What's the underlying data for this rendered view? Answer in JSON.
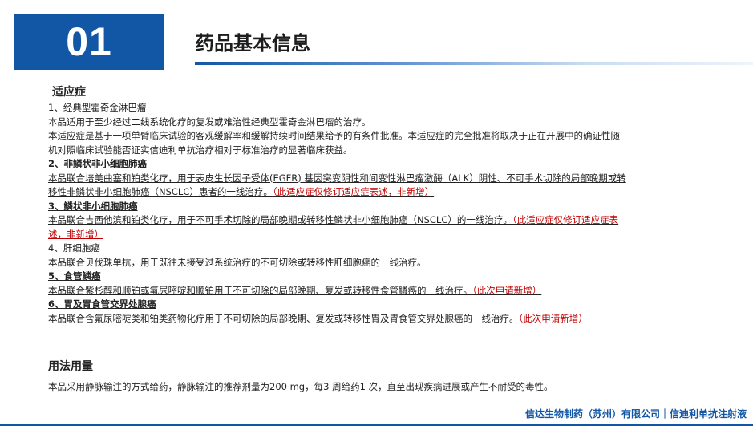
{
  "header": {
    "number": "01",
    "title": "药品基本信息"
  },
  "indications": {
    "title": "适应症",
    "items": [
      {
        "heading": "1、经典型霍奇金淋巴瘤",
        "lines": [
          "本品适用于至少经过二线系统化疗的复发或难治性经典型霍奇金淋巴瘤的治疗。",
          "本适应症是基于一项单臂临床试验的客观缓解率和缓解持续时间结果给予的有条件批准。本适应症的完全批准将取决于正在开展中的确证性随",
          "机对照临床试验能否证实信迪利单抗治疗相对于标准治疗的显著临床获益。"
        ]
      },
      {
        "heading": "2、非鳞状非小细胞肺癌",
        "lines": [
          "本品联合培美曲塞和铂类化疗，用于表皮生长因子受体(EGFR) 基因突变阴性和间变性淋巴瘤激酶（ALK）阴性、不可手术切除的局部晚期或转",
          "移性非鳞状非小细胞肺癌（NSCLC）患者的一线治疗。"
        ],
        "note": "（此适应症仅修订适应症表述，非新增）"
      },
      {
        "heading": "3、鳞状非小细胞肺癌",
        "lines": [
          "本品联合吉西他滨和铂类化疗，用于不可手术切除的局部晚期或转移性鳞状非小细胞肺癌（NSCLC）的一线治疗。"
        ],
        "note_a": "（此适应症仅修订适应症表",
        "note_b": "述，非新增）"
      },
      {
        "heading": "4、肝细胞癌",
        "lines": [
          "本品联合贝伐珠单抗，用于既往未接受过系统治疗的不可切除或转移性肝细胞癌的一线治疗。"
        ]
      },
      {
        "heading": "5、食管鳞癌",
        "lines": [
          "本品联合紫杉醇和顺铂或氟尿嘧啶和顺铂用于不可切除的局部晚期、复发或转移性食管鳞癌的一线治疗。"
        ],
        "note": "（此次申请新增）"
      },
      {
        "heading": "6、胃及胃食管交界处腺癌",
        "lines": [
          "本品联合含氟尿嘧啶类和铂类药物化疗用于不可切除的局部晚期、复发或转移性胃及胃食管交界处腺癌的一线治疗。"
        ],
        "note": "（此次申请新增）"
      }
    ]
  },
  "usage": {
    "title": "用法用量",
    "text": "本品采用静脉输注的方式给药，静脉输注的推荐剂量为200 mg，每3 周给药1 次，直至出现疾病进展或产生不耐受的毒性。"
  },
  "footer": {
    "text": "信达生物制药（苏州）有限公司｜信迪利单抗注射液"
  },
  "colors": {
    "brand_blue": "#1257a6",
    "note_red": "#c00000"
  }
}
